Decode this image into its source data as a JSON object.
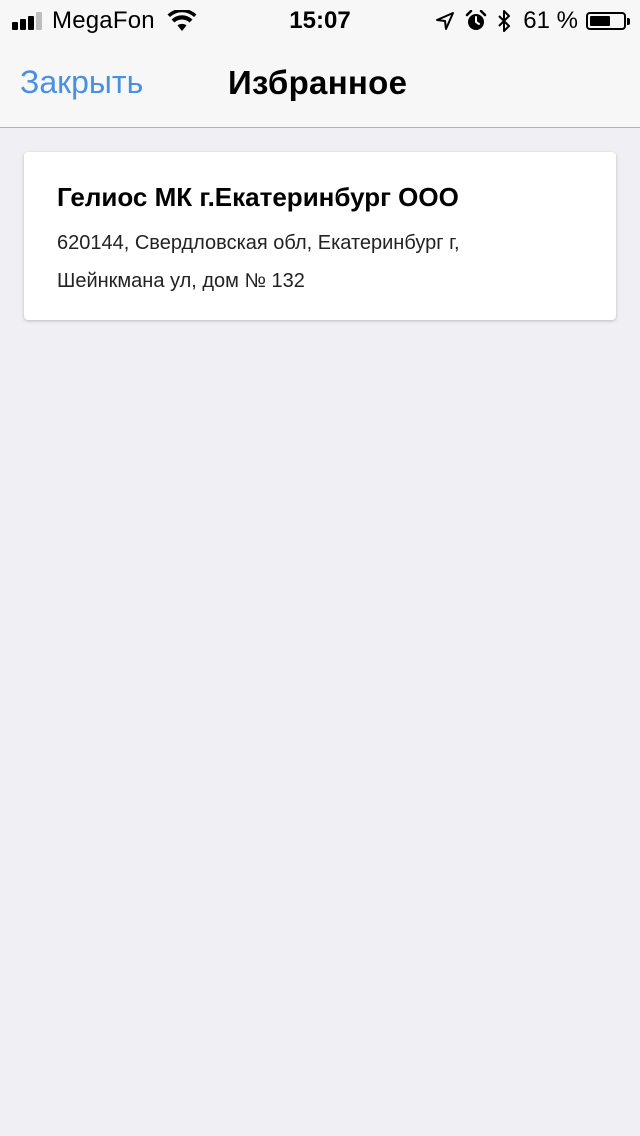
{
  "status_bar": {
    "carrier": "MegaFon",
    "time": "15:07",
    "battery_percent": "61 %",
    "battery_level": 0.61,
    "signal_bars_on": 3,
    "signal_bars_total": 4,
    "icons": [
      "signal-icon",
      "wifi-icon",
      "location-icon",
      "alarm-icon",
      "bluetooth-icon",
      "battery-icon"
    ]
  },
  "nav": {
    "close_label": "Закрыть",
    "title": "Избранное"
  },
  "favorites": [
    {
      "name": "Гелиос МК г.Екатеринбург ООО",
      "address_line1": "620144, Свердловская обл, Екатеринбург г,",
      "address_line2": "Шейнкмана ул, дом № 132"
    }
  ],
  "colors": {
    "accent": "#4a90e2",
    "background": "#efeff4",
    "bar_background": "#f7f7f7"
  }
}
